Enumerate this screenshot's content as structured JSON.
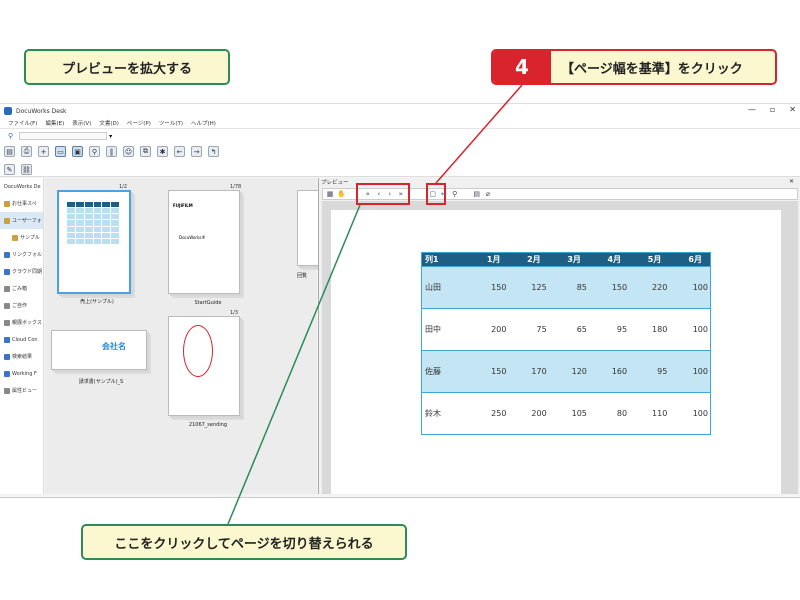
{
  "callouts": {
    "title": "プレビューを拡大する",
    "step_number": "4",
    "step_text": "【ページ幅を基準】をクリック",
    "bottom_note": "ここをクリックしてページを切り替えられる"
  },
  "window": {
    "title": "DocuWorks Desk",
    "controls": [
      "—",
      "▫",
      "✕"
    ]
  },
  "menu": [
    "ファイル(F)",
    "編集(E)",
    "表示(V)",
    "文書(D)",
    "ページ(P)",
    "ツール(T)",
    "ヘルプ(H)"
  ],
  "sidebar": {
    "items": [
      {
        "label": "DocuWorks De",
        "icon": "none"
      },
      {
        "label": "お仕事スペ",
        "icon": "folder"
      },
      {
        "label": "ユーザーフォ",
        "icon": "folder",
        "selected": true
      },
      {
        "label": "サンプル",
        "icon": "folder"
      },
      {
        "label": "リンクフォル",
        "icon": "link"
      },
      {
        "label": "クラウド同期",
        "icon": "cloud"
      },
      {
        "label": "ごみ箱",
        "icon": "trash"
      },
      {
        "label": "ご自作",
        "icon": "user"
      },
      {
        "label": "親展ボックス",
        "icon": "box"
      },
      {
        "label": "Cloud Con",
        "icon": "cloud"
      },
      {
        "label": "検索結果",
        "icon": "search"
      },
      {
        "label": "Working F",
        "icon": "w"
      },
      {
        "label": "属性ビュー",
        "icon": "attr"
      }
    ]
  },
  "documents": [
    {
      "name": "売上(サンプル)",
      "pages": "1/2"
    },
    {
      "name": "StartGuide",
      "pages": "1/78"
    },
    {
      "name": "回覧",
      "pages": ""
    },
    {
      "name": "請求書(サンプル)_S",
      "pages": ""
    },
    {
      "name": "21067_sending",
      "pages": "1/3"
    }
  ],
  "doc_thumb_text": {
    "fujifilm": "FUJIFILM",
    "docuworks": "DocuWorks®",
    "company": "会社名"
  },
  "preview": {
    "title": "プレビュー",
    "close": "✕",
    "nav_buttons": [
      "«",
      "‹",
      "›",
      "»"
    ]
  },
  "table": {
    "headers": [
      "列1",
      "1月",
      "2月",
      "3月",
      "4月",
      "5月",
      "6月"
    ],
    "rows": [
      [
        "山田",
        "150",
        "125",
        "85",
        "150",
        "220",
        "100"
      ],
      [
        "田中",
        "200",
        "75",
        "65",
        "95",
        "180",
        "100"
      ],
      [
        "佐藤",
        "150",
        "170",
        "120",
        "160",
        "95",
        "100"
      ],
      [
        "鈴木",
        "250",
        "200",
        "105",
        "80",
        "110",
        "100"
      ]
    ]
  },
  "colors": {
    "accent_red": "#d9232d",
    "callout_green": "#2e8b57",
    "callout_fill": "#fbf7cf",
    "table_header": "#1e5f86",
    "table_band": "#c4e5f4"
  }
}
